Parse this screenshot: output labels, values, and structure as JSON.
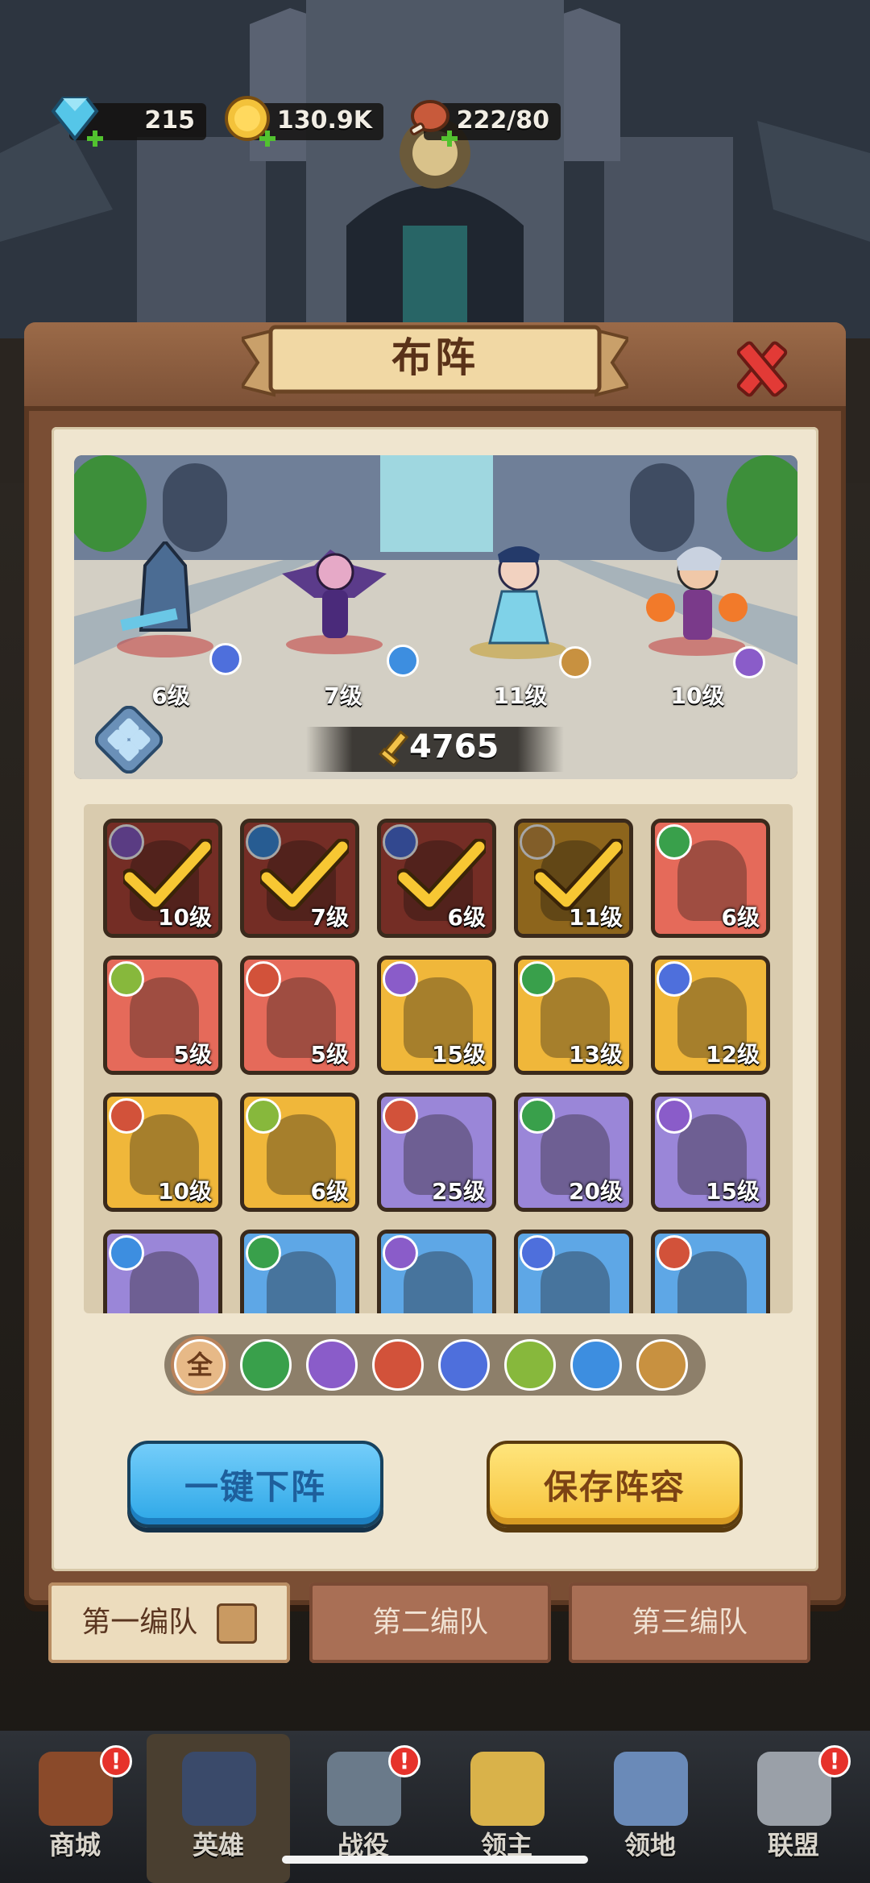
{
  "resources": {
    "gems": "215",
    "gold": "130.9K",
    "stamina": "222/80"
  },
  "panel": {
    "title": "布阵"
  },
  "lineup": {
    "heroes": [
      {
        "level": "6级",
        "class": "paw"
      },
      {
        "level": "7级",
        "class": "swirl"
      },
      {
        "level": "11级",
        "class": "wings"
      },
      {
        "level": "10级",
        "class": "wand"
      }
    ],
    "power": "4765"
  },
  "roster": [
    {
      "level": "10级",
      "class": "wand",
      "bg": "#b3453a",
      "selected": true
    },
    {
      "level": "7级",
      "class": "swirl",
      "bg": "#b3453a",
      "selected": true
    },
    {
      "level": "6级",
      "class": "paw",
      "bg": "#b3453a",
      "selected": true
    },
    {
      "level": "11级",
      "class": "wings",
      "bg": "#d99b2c",
      "selected": true
    },
    {
      "level": "6级",
      "class": "bow",
      "bg": "#e56a5a",
      "selected": false
    },
    {
      "level": "5级",
      "class": "skull",
      "bg": "#e56a5a",
      "selected": false
    },
    {
      "level": "5级",
      "class": "sword",
      "bg": "#e56a5a",
      "selected": false
    },
    {
      "level": "15级",
      "class": "wand",
      "bg": "#f0b73a",
      "selected": false
    },
    {
      "level": "13级",
      "class": "bow",
      "bg": "#f0b73a",
      "selected": false
    },
    {
      "level": "12级",
      "class": "paw",
      "bg": "#f0b73a",
      "selected": false
    },
    {
      "level": "10级",
      "class": "sword",
      "bg": "#f0b73a",
      "selected": false
    },
    {
      "level": "6级",
      "class": "skull",
      "bg": "#f0b73a",
      "selected": false
    },
    {
      "level": "25级",
      "class": "sword",
      "bg": "#9a86d8",
      "selected": false
    },
    {
      "level": "20级",
      "class": "bow",
      "bg": "#9a86d8",
      "selected": false
    },
    {
      "level": "15级",
      "class": "wand",
      "bg": "#9a86d8",
      "selected": false
    },
    {
      "level": "",
      "class": "swirl",
      "bg": "#9a86d8",
      "selected": false
    },
    {
      "level": "",
      "class": "bow",
      "bg": "#5ea7e6",
      "selected": false
    },
    {
      "level": "",
      "class": "wand",
      "bg": "#5ea7e6",
      "selected": false
    },
    {
      "level": "",
      "class": "paw",
      "bg": "#5ea7e6",
      "selected": false
    },
    {
      "level": "",
      "class": "sword",
      "bg": "#5ea7e6",
      "selected": false
    }
  ],
  "filters": [
    {
      "name": "all",
      "label": "全",
      "color": "#e7b987"
    },
    {
      "name": "bow",
      "label": "",
      "color": "#39a04b"
    },
    {
      "name": "wand",
      "label": "",
      "color": "#8a5cc9"
    },
    {
      "name": "sword",
      "label": "",
      "color": "#d2523a"
    },
    {
      "name": "paw",
      "label": "",
      "color": "#4e6fdc"
    },
    {
      "name": "skull",
      "label": "",
      "color": "#87b83c"
    },
    {
      "name": "swirl",
      "label": "",
      "color": "#3d8ee0"
    },
    {
      "name": "wings",
      "label": "",
      "color": "#c89140"
    }
  ],
  "actions": {
    "unequip_all": "一键下阵",
    "save": "保存阵容"
  },
  "teams": [
    "第一编队",
    "第二编队",
    "第三编队"
  ],
  "nav": [
    "商城",
    "英雄",
    "战役",
    "领主",
    "领地",
    "联盟"
  ],
  "class_colors": {
    "paw": "#4e6fdc",
    "swirl": "#3d8ee0",
    "wings": "#c89140",
    "wand": "#8a5cc9",
    "bow": "#39a04b",
    "sword": "#d2523a",
    "skull": "#87b83c"
  }
}
